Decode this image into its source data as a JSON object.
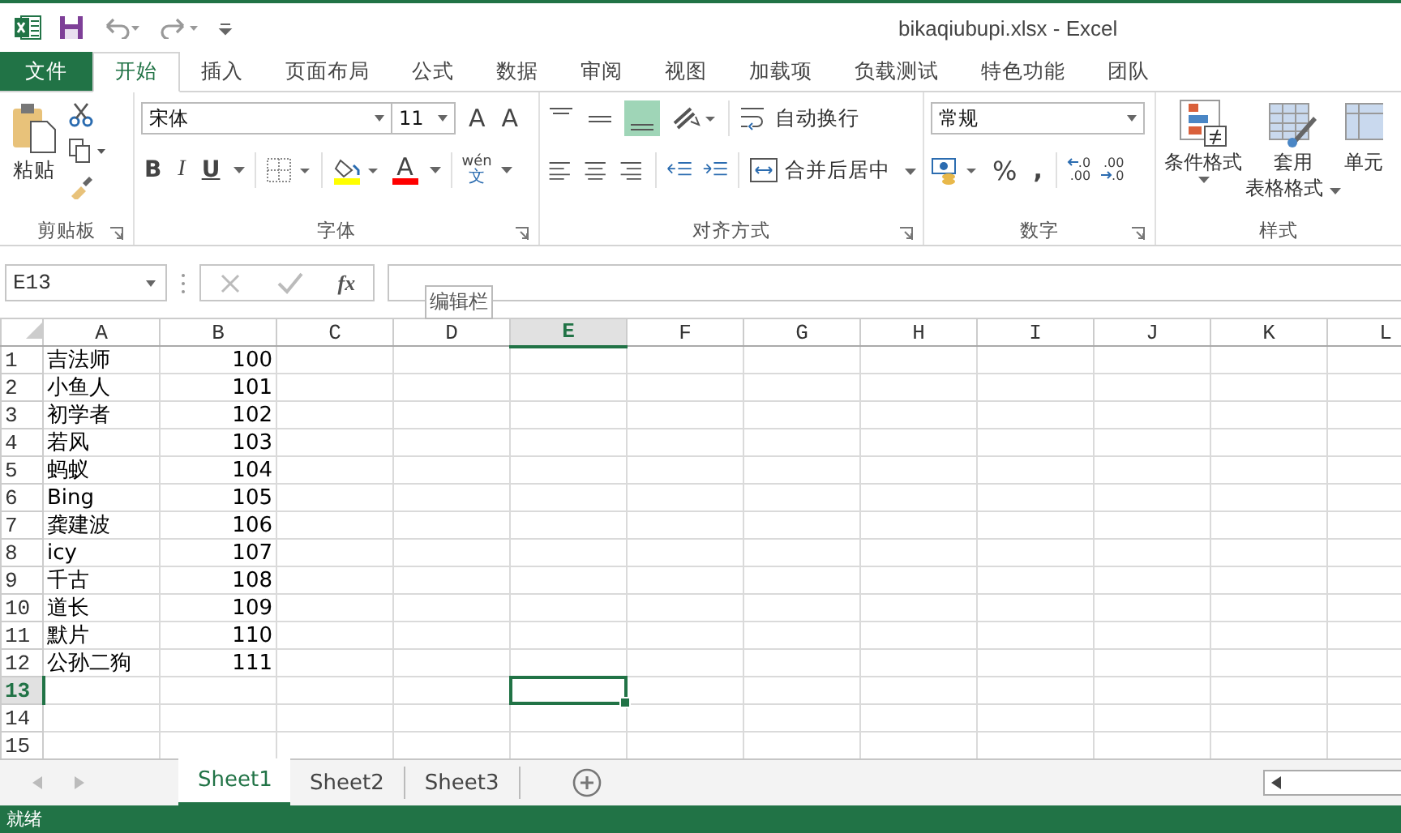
{
  "window": {
    "title": "bikaqiubupi.xlsx - Excel"
  },
  "ribbon_tabs": [
    {
      "label": "文件",
      "kind": "file",
      "selected": false
    },
    {
      "label": "开始",
      "kind": "tab",
      "selected": true
    },
    {
      "label": "插入",
      "kind": "tab",
      "selected": false
    },
    {
      "label": "页面布局",
      "kind": "tab",
      "selected": false
    },
    {
      "label": "公式",
      "kind": "tab",
      "selected": false
    },
    {
      "label": "数据",
      "kind": "tab",
      "selected": false
    },
    {
      "label": "审阅",
      "kind": "tab",
      "selected": false
    },
    {
      "label": "视图",
      "kind": "tab",
      "selected": false
    },
    {
      "label": "加载项",
      "kind": "tab",
      "selected": false
    },
    {
      "label": "负载测试",
      "kind": "tab",
      "selected": false
    },
    {
      "label": "特色功能",
      "kind": "tab",
      "selected": false
    },
    {
      "label": "团队",
      "kind": "tab",
      "selected": false
    }
  ],
  "ribbon": {
    "clipboard": {
      "paste": "粘贴",
      "group_label": "剪贴板"
    },
    "font": {
      "font_name": "宋体",
      "font_size": "11",
      "grow": "A",
      "shrink": "A",
      "bold": "B",
      "italic": "I",
      "underline": "U",
      "font_color": "A",
      "phonetic_top": "wén",
      "phonetic_bottom": "文",
      "group_label": "字体"
    },
    "alignment": {
      "wrap_text": "自动换行",
      "merge_center": "合并后居中",
      "group_label": "对齐方式"
    },
    "number": {
      "format": "常规",
      "percent": "%",
      "comma": ",",
      "increase_decimal": [
        ".0",
        ".00"
      ],
      "decrease_decimal": [
        ".00",
        ".0"
      ],
      "group_label": "数字"
    },
    "styles": {
      "conditional_formatting": "条件格式",
      "format_as_table": [
        "套用",
        "表格格式"
      ],
      "cell_styles": "单元",
      "group_label": "样式"
    }
  },
  "formula_bar": {
    "name_box": "E13",
    "fx": "fx",
    "tooltip": "编辑栏"
  },
  "grid": {
    "columns": [
      {
        "label": "A",
        "selected": false
      },
      {
        "label": "B",
        "selected": false
      },
      {
        "label": "C",
        "selected": false
      },
      {
        "label": "D",
        "selected": false
      },
      {
        "label": "E",
        "selected": true
      },
      {
        "label": "F",
        "selected": false
      },
      {
        "label": "G",
        "selected": false
      },
      {
        "label": "H",
        "selected": false
      },
      {
        "label": "I",
        "selected": false
      },
      {
        "label": "J",
        "selected": false
      },
      {
        "label": "K",
        "selected": false
      },
      {
        "label": "L",
        "selected": false
      }
    ],
    "rows": [
      {
        "number": "1",
        "selected": false,
        "cells": [
          "吉法师",
          "100"
        ]
      },
      {
        "number": "2",
        "selected": false,
        "cells": [
          "小鱼人",
          "101"
        ]
      },
      {
        "number": "3",
        "selected": false,
        "cells": [
          "初学者",
          "102"
        ]
      },
      {
        "number": "4",
        "selected": false,
        "cells": [
          "若风",
          "103"
        ]
      },
      {
        "number": "5",
        "selected": false,
        "cells": [
          "蚂蚁",
          "104"
        ]
      },
      {
        "number": "6",
        "selected": false,
        "cells": [
          "Bing",
          "105"
        ]
      },
      {
        "number": "7",
        "selected": false,
        "cells": [
          "龚建波",
          "106"
        ]
      },
      {
        "number": "8",
        "selected": false,
        "cells": [
          "icy",
          "107"
        ]
      },
      {
        "number": "9",
        "selected": false,
        "cells": [
          "千古",
          "108"
        ]
      },
      {
        "number": "10",
        "selected": false,
        "cells": [
          "道长",
          "109"
        ]
      },
      {
        "number": "11",
        "selected": false,
        "cells": [
          "默片",
          "110"
        ]
      },
      {
        "number": "12",
        "selected": false,
        "cells": [
          "公孙二狗",
          "111"
        ]
      },
      {
        "number": "13",
        "selected": true
      },
      {
        "number": "14",
        "selected": false
      },
      {
        "number": "15",
        "selected": false
      }
    ]
  },
  "sheet_tabs": [
    {
      "label": "Sheet1",
      "selected": true
    },
    {
      "label": "Sheet2",
      "selected": false
    },
    {
      "label": "Sheet3",
      "selected": false
    }
  ],
  "status_bar": {
    "text": "就绪"
  }
}
